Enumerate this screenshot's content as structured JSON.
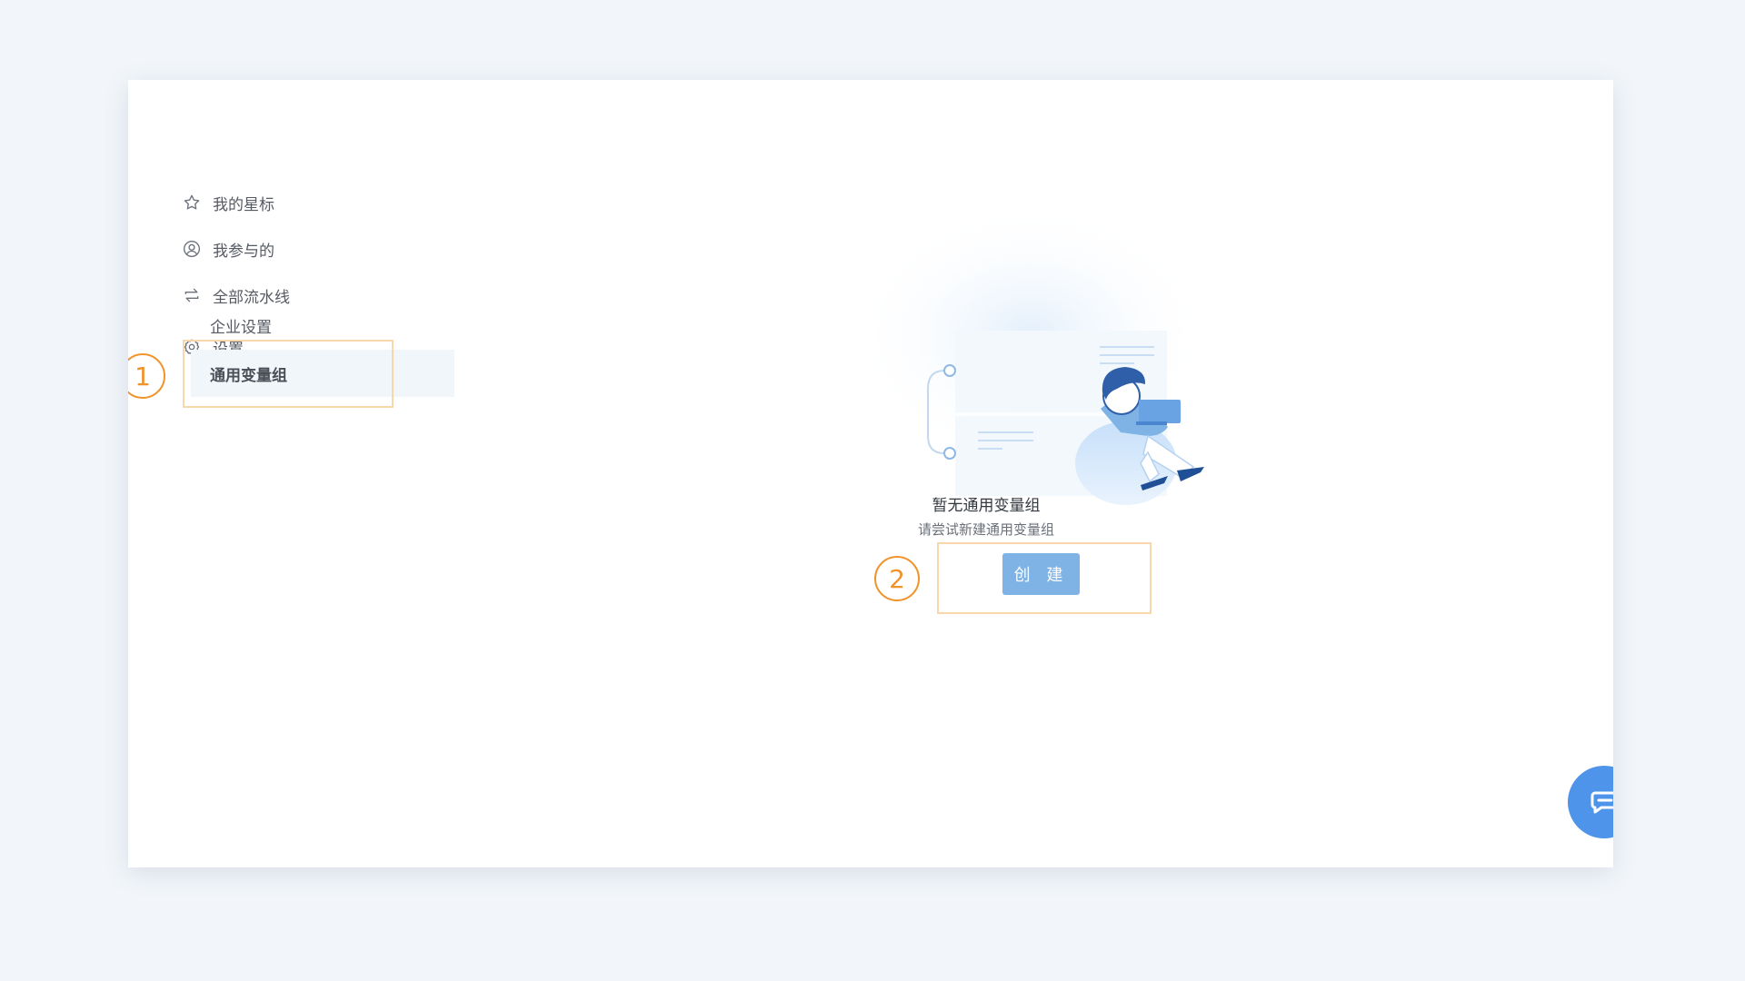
{
  "sidebar": {
    "items": [
      {
        "label": "我的星标",
        "icon": "star-icon"
      },
      {
        "label": "我参与的",
        "icon": "user-circle-icon"
      },
      {
        "label": "全部流水线",
        "icon": "swap-arrows-icon"
      },
      {
        "label": "设置",
        "icon": "gear-icon"
      }
    ],
    "settings_children": [
      {
        "label": "企业设置"
      },
      {
        "label": "通用变量组",
        "active": true
      }
    ]
  },
  "steps": {
    "one": "1",
    "two": "2"
  },
  "empty_state": {
    "title": "暂无通用变量组",
    "subtitle": "请尝试新建通用变量组",
    "create_label": "创 建"
  },
  "colors": {
    "page_bg": "#f2f6fa",
    "accent": "#7fb2e5",
    "highlight_border": "#f9d7ac",
    "step_orange": "#f0932b",
    "fab_blue": "#4d94ea",
    "active_bg": "#f1f6fb"
  },
  "chat": {
    "icon": "chat-bubble-icon"
  }
}
